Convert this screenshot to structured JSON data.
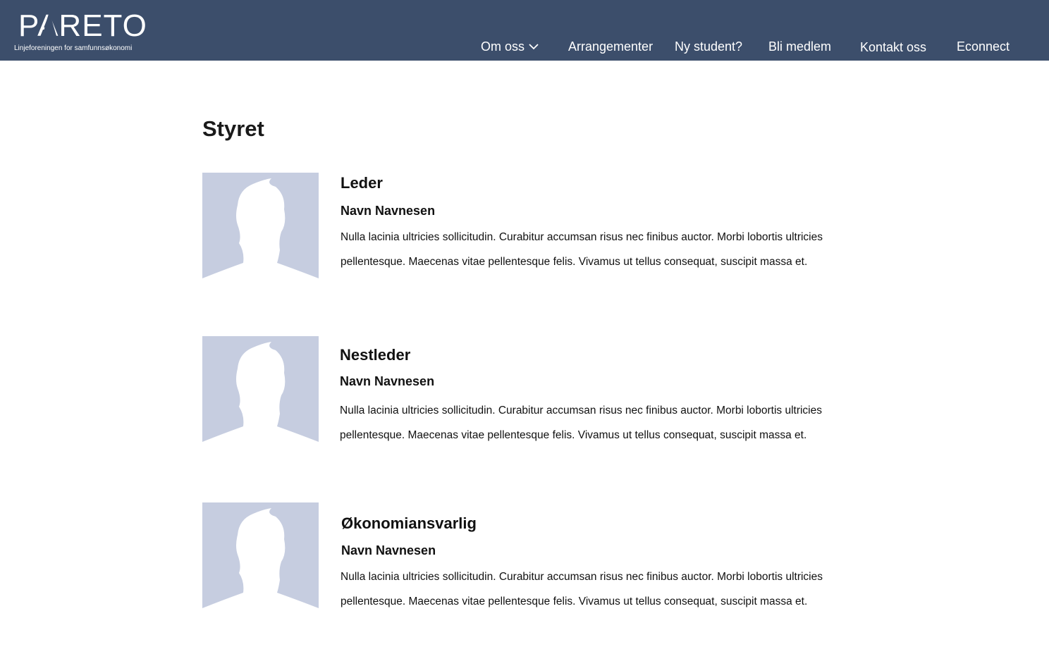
{
  "header": {
    "logo_text": "PARETO",
    "logo_tagline": "Linjeforeningen for samfunnsøkonomi",
    "bg_color": "#3c4e6b",
    "nav": [
      {
        "label": "Om oss",
        "has_dropdown": true,
        "icon": "chevron-down-icon"
      },
      {
        "label": "Arrangementer"
      },
      {
        "label": "Ny student?"
      },
      {
        "label": "Bli medlem"
      },
      {
        "label": "Kontakt oss"
      },
      {
        "label": "Econnect"
      }
    ]
  },
  "main": {
    "title": "Styret",
    "members": [
      {
        "role": "Leder",
        "name": "Navn Navnesen",
        "bio_line1": "Nulla lacinia ultricies sollicitudin. Curabitur accumsan risus nec finibus auctor. Morbi lobortis ultricies",
        "bio_line2": " pellentesque. Maecenas vitae pellentesque felis. Vivamus ut tellus consequat, suscipit massa et.",
        "icon": "avatar-placeholder-icon"
      },
      {
        "role": "Nestleder",
        "name": "Navn Navnesen",
        "bio_line1": "Nulla lacinia ultricies sollicitudin. Curabitur accumsan risus nec finibus auctor. Morbi lobortis ultricies",
        "bio_line2": " pellentesque. Maecenas vitae pellentesque felis. Vivamus ut tellus consequat, suscipit massa et.",
        "icon": "avatar-placeholder-icon"
      },
      {
        "role": "Økonomiansvarlig",
        "name": "Navn Navnesen",
        "bio_line1": "Nulla lacinia ultricies sollicitudin. Curabitur accumsan risus nec finibus auctor. Morbi lobortis ultricies",
        "bio_line2": " pellentesque. Maecenas vitae pellentesque felis. Vivamus ut tellus consequat, suscipit massa et.",
        "icon": "avatar-placeholder-icon"
      }
    ]
  },
  "colors": {
    "avatar_bg": "#c6cde0",
    "text": "#111111",
    "nav_text": "#ffffff"
  }
}
